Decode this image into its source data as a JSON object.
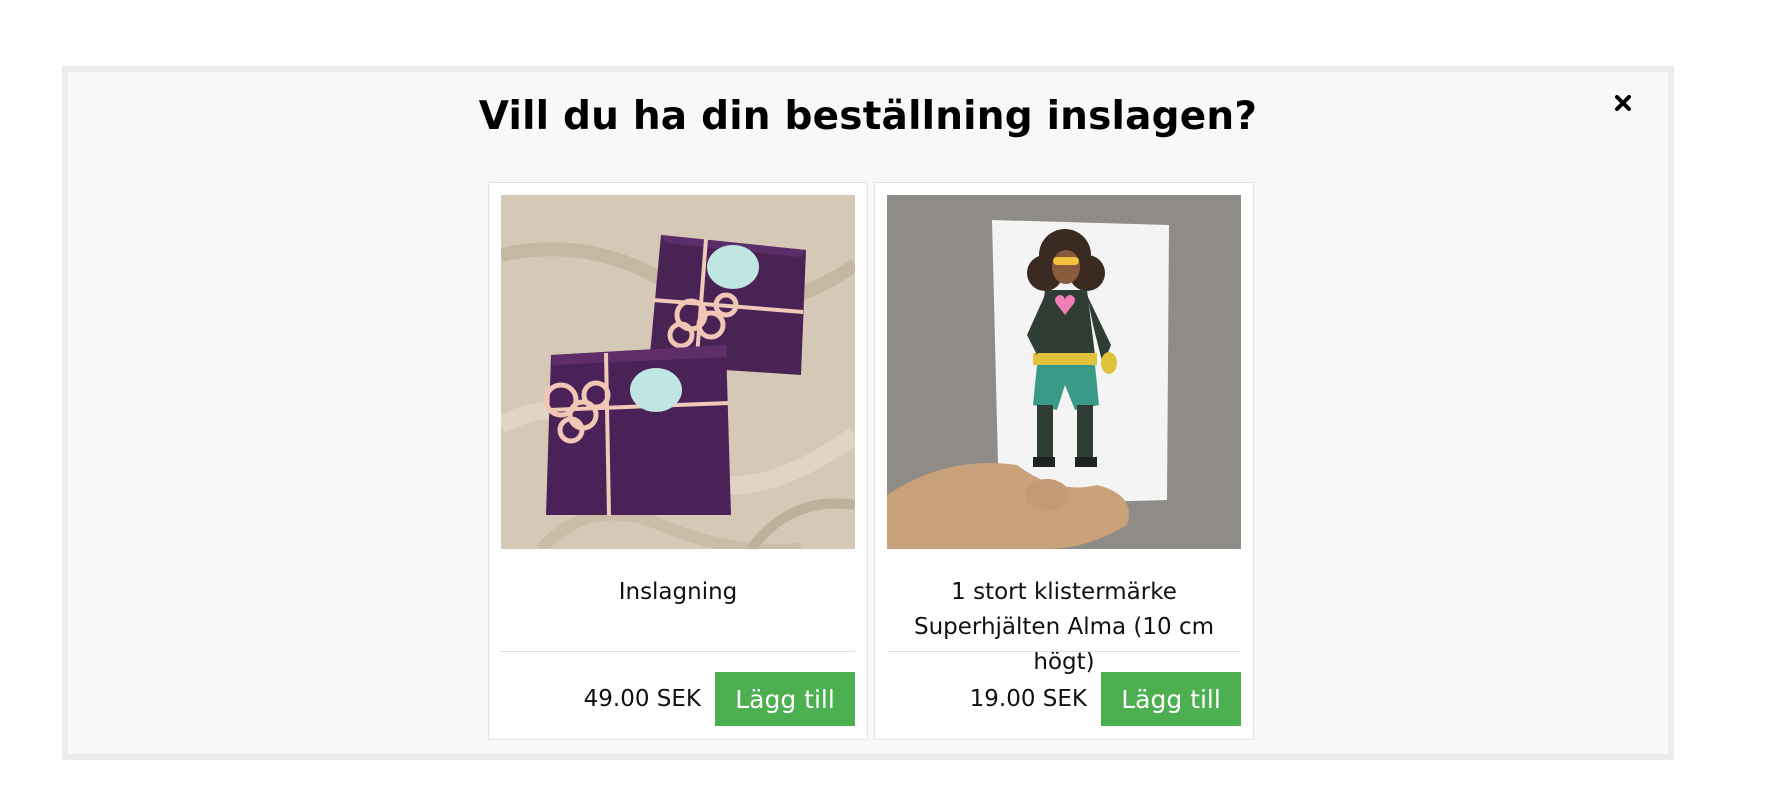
{
  "modal": {
    "title": "Vill du ha din beställning inslagen?",
    "close_icon": "close-icon"
  },
  "products": [
    {
      "name": "Inslagning",
      "price": "49.00 SEK",
      "button_label": "Lägg till",
      "image_icon": "gift-wrap-photo"
    },
    {
      "name": "1 stort klistermärke Superhjälten Alma (10 cm högt)",
      "price": "19.00 SEK",
      "button_label": "Lägg till",
      "image_icon": "sticker-photo"
    }
  ],
  "colors": {
    "button": "#4caf50",
    "modal_background": "#f8f8f8",
    "modal_border": "#ececec"
  }
}
